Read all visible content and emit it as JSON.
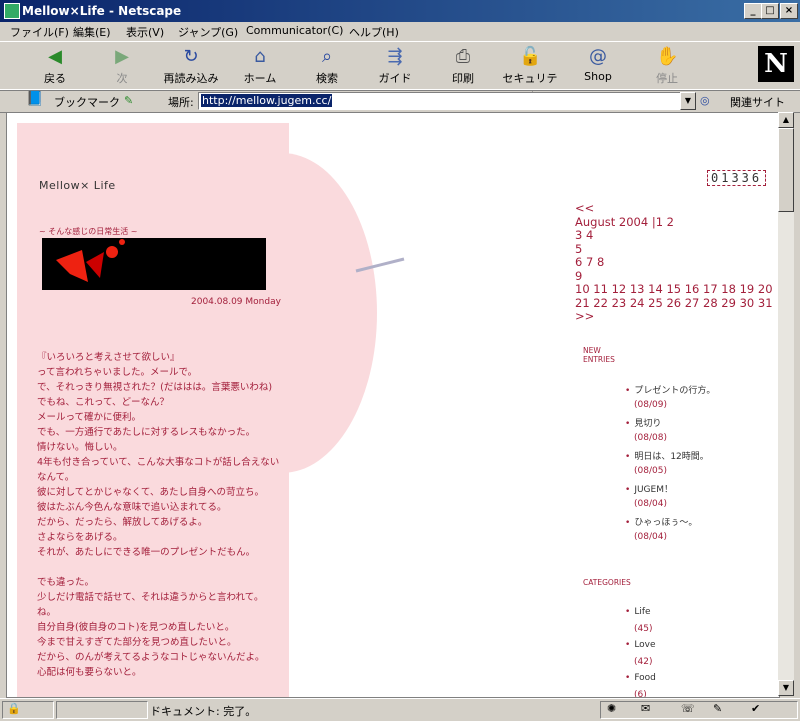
{
  "window": {
    "title": "Mellow×Life - Netscape"
  },
  "menu": [
    "ファイル(F)",
    "編集(E)",
    "表示(V)",
    "ジャンプ(G)",
    "Communicator(C)",
    "ヘルプ(H)"
  ],
  "toolbar": {
    "back": "戻る",
    "forward": "次",
    "reload": "再読み込み",
    "home": "ホーム",
    "search": "検索",
    "guide": "ガイド",
    "print": "印刷",
    "security": "セキュリティ",
    "shop": "Shop",
    "stop": "停止"
  },
  "location": {
    "bookmarks": "ブックマーク",
    "label": "場所:",
    "url": "http://mellow.jugem.cc/",
    "related": "関連サイト"
  },
  "page": {
    "title": "Mellow× Life",
    "subtitle": "~ そんな感じの日常生活 ~",
    "counter": "01336",
    "post_date": "2004.08.09 Monday",
    "post_lines": [
      "『いろいろと考えさせて欲しい』",
      "って言われちゃいました。メールで。",
      "で、それっきり無視された？(だははは。言葉悪いわね)",
      "でもね、これって、どーなん？",
      "メールって確かに便利。",
      "でも、一方通行であたしに対するレスもなかった。",
      "情けない。悔しい。",
      "4年も付き合っていて、こんな大事なコトが話し合えない",
      "なんて。",
      "彼に対してとかじゃなくて、あたし自身への苛立ち。",
      "彼はたぶん今色んな意味で追い込まれてる。",
      "だから、だったら、解放してあげるよ。",
      "さよならをあげる。",
      "それが、あたしにできる唯一のプレゼントだもん。",
      "",
      "でも違った。",
      "少しだけ電話で話せて、それは違うからと言われて。",
      "ね。",
      "自分自身(彼自身のコト)を見つめ直したいと。",
      "今まで甘えすぎてた部分を見つめ直したいと。",
      "だから、のんが考えてるようなコトじゃないんだよ。",
      "心配は何も要らないと。"
    ],
    "calendar": {
      "prev": "<<",
      "next": ">>",
      "month": "August 2004",
      "lines": [
        "|1 2",
        "3 4",
        "5",
        "6 7 8",
        "9",
        "10 11 12 13 14 15 16 17 18 19 20",
        "21 22 23 24 25 26 27 28 29 30 31"
      ]
    },
    "new_entries_heading_1": "NEW",
    "new_entries_heading_2": "ENTRIES",
    "new_entries": [
      {
        "title": "プレゼントの行方。",
        "date": "(08/09)"
      },
      {
        "title": "見切り",
        "date": "(08/08)"
      },
      {
        "title": "明日は、12時間。",
        "date": "(08/05)"
      },
      {
        "title": "JUGEM！",
        "date": "(08/04)"
      },
      {
        "title": "ひゃっほぅ～。",
        "date": "(08/04)"
      }
    ],
    "categories_heading": "CATEGORIES",
    "categories": [
      {
        "name": "Life",
        "count": "(45)"
      },
      {
        "name": "Love",
        "count": "(42)"
      },
      {
        "name": "Food",
        "count": "(6)"
      }
    ]
  },
  "status": {
    "text": "ドキュメント: 完了。"
  },
  "icons": [
    "netscape-logo-icon",
    "back-icon",
    "forward-icon",
    "reload-icon",
    "home-icon",
    "search-icon",
    "guide-icon",
    "print-icon",
    "security-icon",
    "shop-icon",
    "stop-icon",
    "bookmark-icon"
  ]
}
